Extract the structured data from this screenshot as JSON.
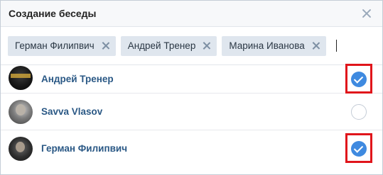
{
  "dialog": {
    "title": "Создание беседы",
    "close_icon": "close-icon"
  },
  "tokens": [
    {
      "label": "Герман Филипвич"
    },
    {
      "label": "Андрей Тренер"
    },
    {
      "label": "Марина Иванова"
    }
  ],
  "contacts": [
    {
      "name": "Андрей Тренер",
      "selected": true
    },
    {
      "name": "Savva Vlasov",
      "selected": false
    },
    {
      "name": "Герман Филипвич",
      "selected": true
    }
  ],
  "colors": {
    "accent": "#3f8ae0",
    "link": "#2a5885",
    "highlight": "#e0151b",
    "token_bg": "#dfe6ee"
  }
}
